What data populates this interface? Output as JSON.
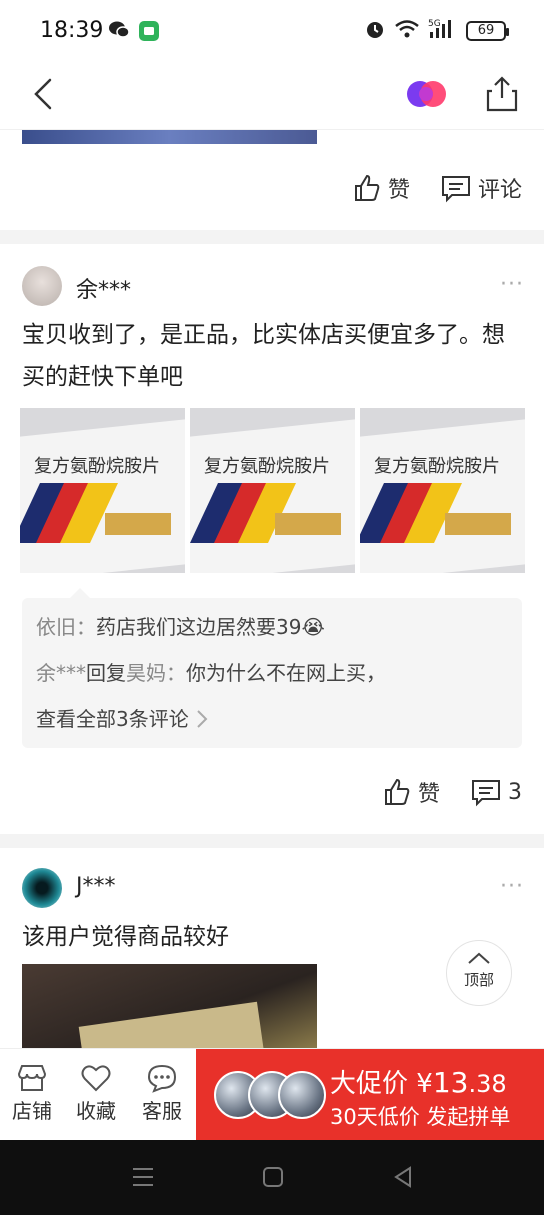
{
  "status_bar": {
    "time": "18:39",
    "battery": "69",
    "network": "5G"
  },
  "previous_review": {
    "like_label": "赞",
    "comment_label": "评论"
  },
  "review1": {
    "username": "余***",
    "more": "···",
    "text": "宝贝收到了，是正品，比实体店买便宜多了。想买的赶快下单吧",
    "product_label": "复方氨酚烷胺片",
    "comments": [
      {
        "author": "依旧",
        "sep": "：",
        "text": "药店我们这边居然要39",
        "emoji": "😭"
      },
      {
        "author": "余***",
        "reply_word": "回复",
        "reply_to": "昊妈",
        "sep": "：",
        "text": "你为什么不在网上买，"
      }
    ],
    "view_all": "查看全部3条评论",
    "like_label": "赞",
    "comment_count": "3"
  },
  "review2": {
    "username": "J***",
    "more": "···",
    "text": "该用户觉得商品较好"
  },
  "back_to_top": "顶部",
  "bottom_bar": {
    "store": "店铺",
    "favorite": "收藏",
    "service": "客服",
    "promo_label": "大促价",
    "price_symbol": "¥",
    "price_int": "13",
    "price_dec": ".38",
    "promo_sub": "30天低价 发起拼单"
  },
  "colors": {
    "promo_bg": "#e8312a",
    "separator": "#f3f3f3"
  }
}
